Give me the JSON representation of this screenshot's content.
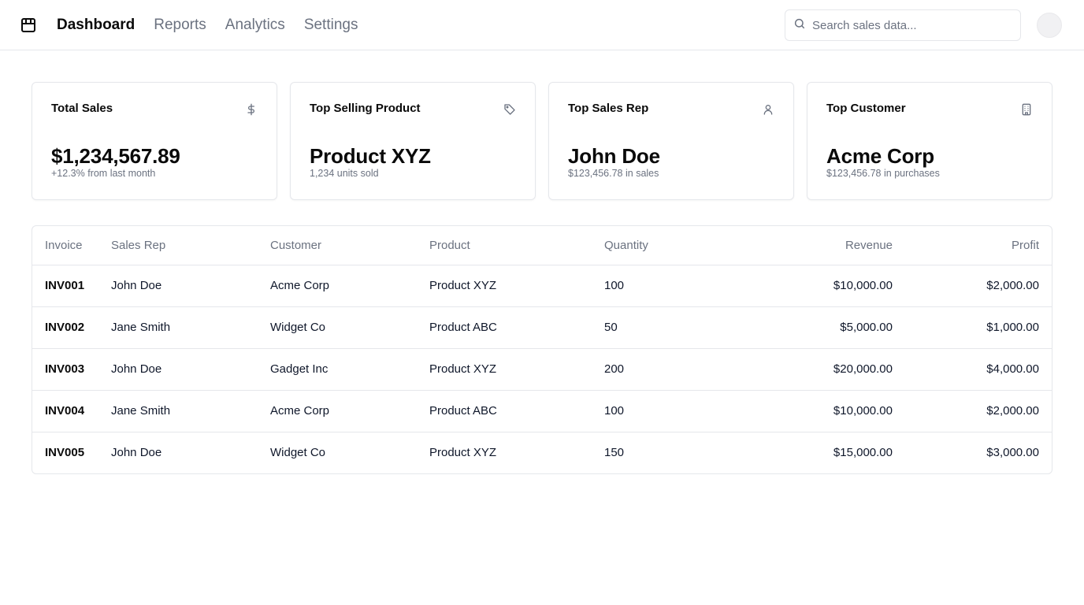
{
  "nav": {
    "logo_icon": "box-icon",
    "items": [
      {
        "label": "Dashboard",
        "active": true
      },
      {
        "label": "Reports",
        "active": false
      },
      {
        "label": "Analytics",
        "active": false
      },
      {
        "label": "Settings",
        "active": false
      }
    ]
  },
  "search": {
    "placeholder": "Search sales data...",
    "value": "",
    "icon": "search-icon"
  },
  "cards": [
    {
      "title": "Total Sales",
      "icon": "dollar-icon",
      "value": "$1,234,567.89",
      "sub": "+12.3% from last month"
    },
    {
      "title": "Top Selling Product",
      "icon": "tag-icon",
      "value": "Product XYZ",
      "sub": "1,234 units sold"
    },
    {
      "title": "Top Sales Rep",
      "icon": "user-icon",
      "value": "John Doe",
      "sub": "$123,456.78 in sales"
    },
    {
      "title": "Top Customer",
      "icon": "building-icon",
      "value": "Acme Corp",
      "sub": "$123,456.78 in purchases"
    }
  ],
  "table": {
    "headers": {
      "invoice": "Invoice",
      "rep": "Sales Rep",
      "customer": "Customer",
      "product": "Product",
      "quantity": "Quantity",
      "revenue": "Revenue",
      "profit": "Profit"
    },
    "rows": [
      {
        "invoice": "INV001",
        "rep": "John Doe",
        "customer": "Acme Corp",
        "product": "Product XYZ",
        "quantity": "100",
        "revenue": "$10,000.00",
        "profit": "$2,000.00"
      },
      {
        "invoice": "INV002",
        "rep": "Jane Smith",
        "customer": "Widget Co",
        "product": "Product ABC",
        "quantity": "50",
        "revenue": "$5,000.00",
        "profit": "$1,000.00"
      },
      {
        "invoice": "INV003",
        "rep": "John Doe",
        "customer": "Gadget Inc",
        "product": "Product XYZ",
        "quantity": "200",
        "revenue": "$20,000.00",
        "profit": "$4,000.00"
      },
      {
        "invoice": "INV004",
        "rep": "Jane Smith",
        "customer": "Acme Corp",
        "product": "Product ABC",
        "quantity": "100",
        "revenue": "$10,000.00",
        "profit": "$2,000.00"
      },
      {
        "invoice": "INV005",
        "rep": "John Doe",
        "customer": "Widget Co",
        "product": "Product XYZ",
        "quantity": "150",
        "revenue": "$15,000.00",
        "profit": "$3,000.00"
      }
    ]
  }
}
